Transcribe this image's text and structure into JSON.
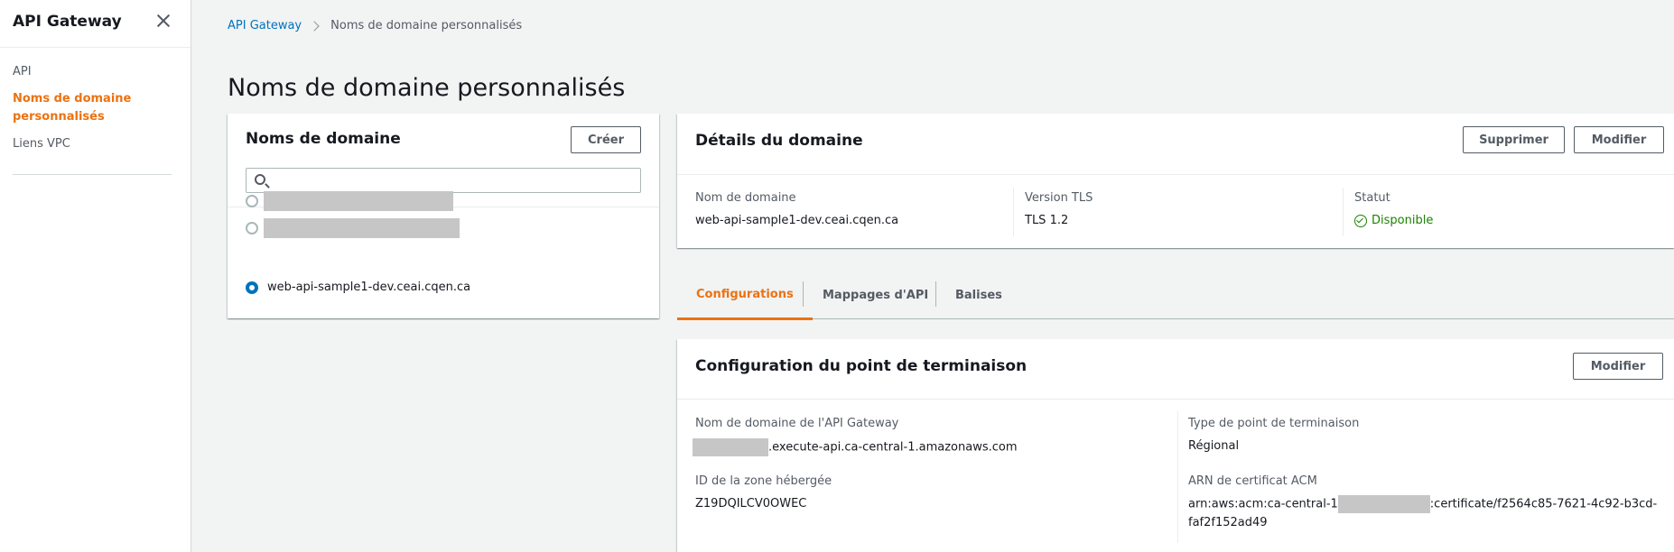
{
  "sidebar": {
    "title": "API Gateway",
    "items": [
      {
        "label": "API"
      },
      {
        "label": "Noms de domaine personnalisés"
      },
      {
        "label": "Liens VPC"
      }
    ]
  },
  "breadcrumb": {
    "root": "API Gateway",
    "current": "Noms de domaine personnalisés"
  },
  "page_title": "Noms de domaine personnalisés",
  "domains_panel": {
    "title": "Noms de domaine",
    "create_label": "Créer",
    "search_value": "",
    "items": [
      {
        "label": "",
        "redacted": true,
        "selected": false
      },
      {
        "label": "",
        "redacted": true,
        "selected": false
      },
      {
        "label": "web-api-sample1-dev.ceai.cqen.ca",
        "redacted": false,
        "selected": true
      }
    ]
  },
  "details_panel": {
    "title": "Détails du domaine",
    "delete_label": "Supprimer",
    "edit_label": "Modifier",
    "domain_name_label": "Nom de domaine",
    "domain_name_value": "web-api-sample1-dev.ceai.cqen.ca",
    "tls_label": "Version TLS",
    "tls_value": "TLS 1.2",
    "status_label": "Statut",
    "status_value": "Disponible"
  },
  "tabs": [
    {
      "label": "Configurations",
      "active": true
    },
    {
      "label": "Mappages d'API",
      "active": false
    },
    {
      "label": "Balises",
      "active": false
    }
  ],
  "endpoint_panel": {
    "title": "Configuration du point de terminaison",
    "edit_label": "Modifier",
    "gw_domain_label": "Nom de domaine de l'API Gateway",
    "gw_domain_suffix": ".execute-api.ca-central-1.amazonaws.com",
    "endpoint_type_label": "Type de point de terminaison",
    "endpoint_type_value": "Régional",
    "hosted_zone_label": "ID de la zone hébergée",
    "hosted_zone_value": "Z19DQILCV0OWEC",
    "acm_label": "ARN de certificat ACM",
    "acm_prefix": "arn:aws:acm:ca-central-1",
    "acm_suffix": ":certificate/f2564c85-7621-4c92-b3cd-faf2f152ad49"
  },
  "colors": {
    "accent": "#ec7211",
    "link": "#0073bb",
    "success": "#1d8102"
  }
}
